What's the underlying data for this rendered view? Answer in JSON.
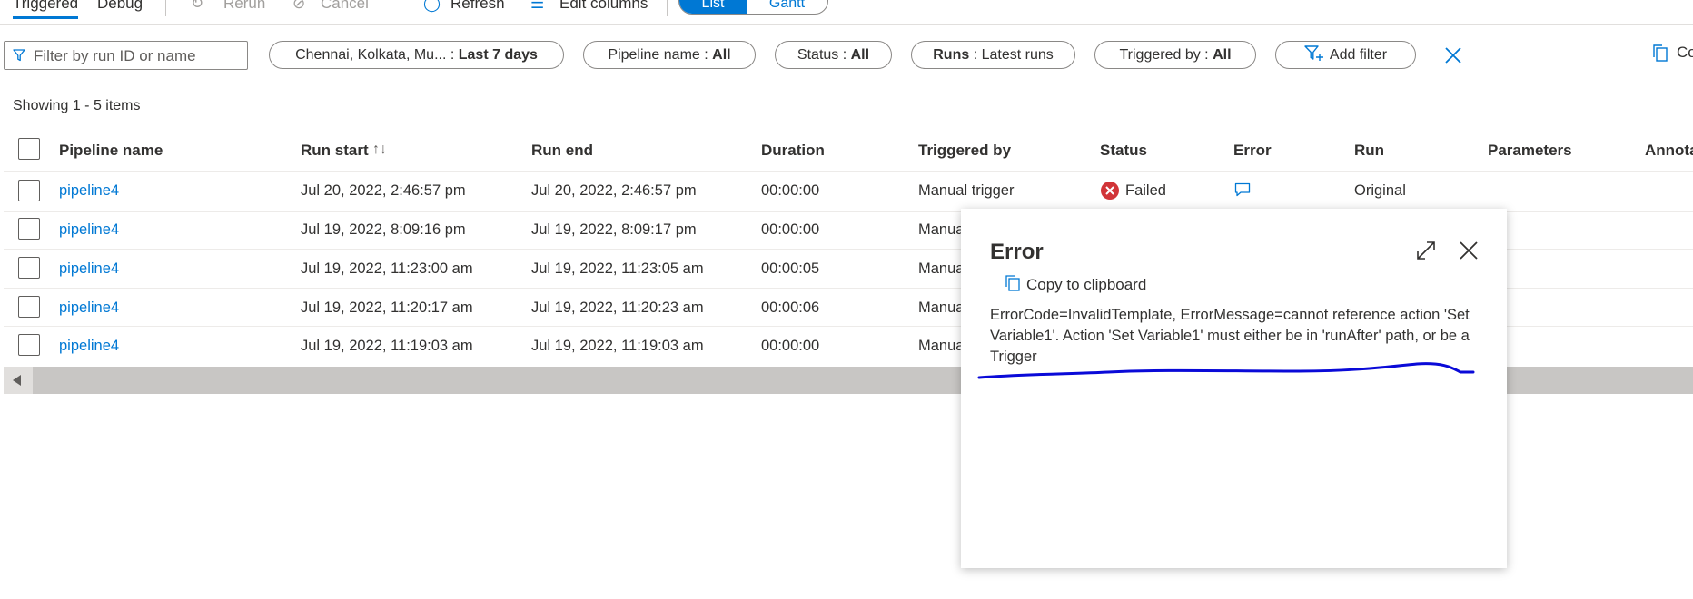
{
  "toolbar": {
    "tab_triggered": "Triggered",
    "tab_debug": "Debug",
    "rerun_label": "Rerun",
    "cancel_label": "Cancel",
    "refresh_label": "Refresh",
    "edit_columns_label": "Edit columns",
    "view_list": "List",
    "view_gantt": "Gantt"
  },
  "filters": {
    "search_placeholder": "Filter by run ID or name",
    "region_label": "Chennai, Kolkata, Mu...",
    "region_value": "Last 7 days",
    "pipeline_label": "Pipeline name",
    "pipeline_value": "All",
    "status_label": "Status",
    "status_value": "All",
    "runs_label": "Runs",
    "runs_value": "Latest runs",
    "triggered_label": "Triggered by",
    "triggered_value": "All",
    "add_filter_label": "Add filter",
    "copy_label": "Co"
  },
  "showing_text": "Showing 1 - 5 items",
  "table": {
    "headers": {
      "pipeline": "Pipeline name",
      "run_start": "Run start",
      "run_end": "Run end",
      "duration": "Duration",
      "triggered_by": "Triggered by",
      "status": "Status",
      "error": "Error",
      "run": "Run",
      "parameters": "Parameters",
      "annotations": "Annota"
    },
    "rows": [
      {
        "name": "pipeline4",
        "start": "Jul 20, 2022, 2:46:57 pm",
        "end": "Jul 20, 2022, 2:46:57 pm",
        "duration": "00:00:00",
        "triggered": "Manual trigger",
        "status": "Failed",
        "run": "Original"
      },
      {
        "name": "pipeline4",
        "start": "Jul 19, 2022, 8:09:16 pm",
        "end": "Jul 19, 2022, 8:09:17 pm",
        "duration": "00:00:00",
        "triggered": "Manua"
      },
      {
        "name": "pipeline4",
        "start": "Jul 19, 2022, 11:23:00 am",
        "end": "Jul 19, 2022, 11:23:05 am",
        "duration": "00:00:05",
        "triggered": "Manua"
      },
      {
        "name": "pipeline4",
        "start": "Jul 19, 2022, 11:20:17 am",
        "end": "Jul 19, 2022, 11:20:23 am",
        "duration": "00:00:06",
        "triggered": "Manua"
      },
      {
        "name": "pipeline4",
        "start": "Jul 19, 2022, 11:19:03 am",
        "end": "Jul 19, 2022, 11:19:03 am",
        "duration": "00:00:00",
        "triggered": "Manua"
      }
    ]
  },
  "error_popup": {
    "title": "Error",
    "copy_label": "Copy to clipboard",
    "message": "ErrorCode=InvalidTemplate, ErrorMessage=cannot reference action 'Set Variable1'. Action 'Set Variable1' must either be in 'runAfter' path, or be a Trigger"
  },
  "colors": {
    "accent": "#0078d4",
    "failed": "#d13438",
    "annotation_ink": "#0a0ad8"
  }
}
